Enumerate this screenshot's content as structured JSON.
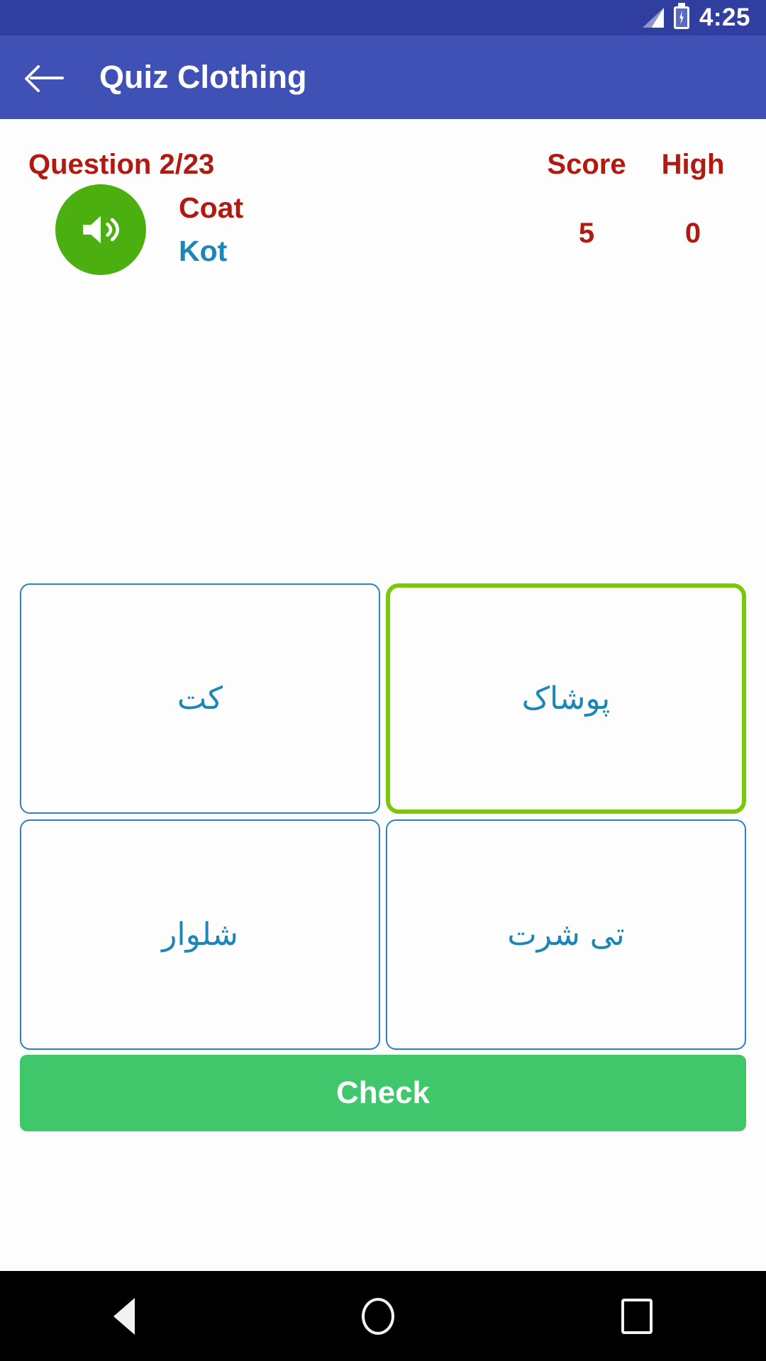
{
  "status_bar": {
    "time": "4:25",
    "signal_icon": "signal-bars-icon",
    "battery_icon": "battery-charging-icon"
  },
  "app_bar": {
    "back_icon": "back-arrow-icon",
    "title": "Quiz Clothing"
  },
  "quiz": {
    "question_label": "Question 2/23",
    "score_header": "Score",
    "high_header": "High",
    "score_value": "5",
    "high_value": "0",
    "speaker_icon": "speaker-volume-icon",
    "word_english": "Coat",
    "word_transliteration": "Kot",
    "options": [
      {
        "text": "کت",
        "selected": false
      },
      {
        "text": "پوشاک",
        "selected": true
      },
      {
        "text": "شلوار",
        "selected": false
      },
      {
        "text": "تی شرت",
        "selected": false
      }
    ],
    "check_label": "Check"
  },
  "nav_bar": {
    "back_icon": "nav-back-triangle-icon",
    "home_icon": "nav-home-circle-icon",
    "recents_icon": "nav-recents-square-icon"
  },
  "colors": {
    "status_bar": "#303f9f",
    "app_bar": "#3f51b5",
    "accent_red": "#b01a10",
    "accent_blue": "#1b86b8",
    "speaker_green": "#4caf10",
    "selected_green": "#7ac70c",
    "check_green": "#40c76c"
  }
}
